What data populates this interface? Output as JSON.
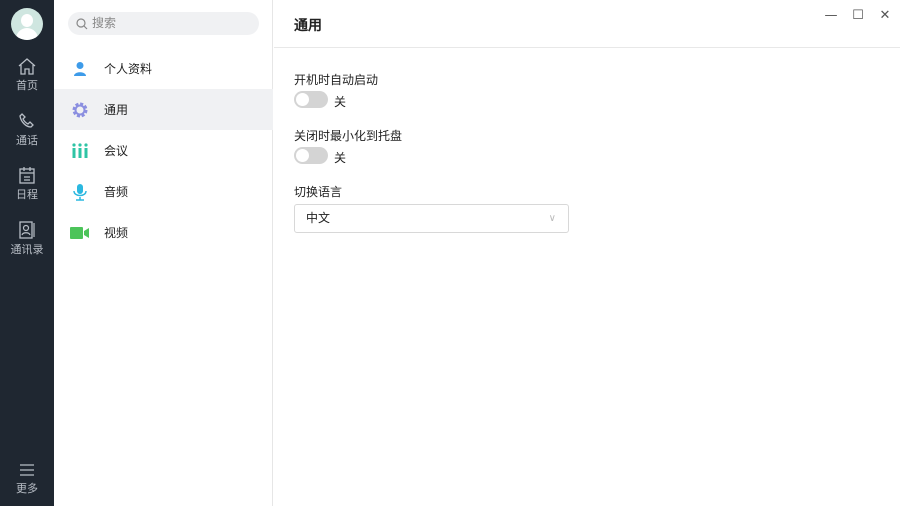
{
  "rail": {
    "items": [
      {
        "label": "首页",
        "icon": "home-icon"
      },
      {
        "label": "通话",
        "icon": "phone-icon"
      },
      {
        "label": "日程",
        "icon": "calendar-icon"
      },
      {
        "label": "通讯录",
        "icon": "contacts-icon"
      }
    ],
    "more": "更多"
  },
  "search": {
    "placeholder": "搜索"
  },
  "menu": [
    {
      "label": "个人资料",
      "icon": "user-icon",
      "color": "#3d9be9"
    },
    {
      "label": "通用",
      "icon": "gear-icon",
      "color": "#8b8fe0"
    },
    {
      "label": "会议",
      "icon": "meeting-icon",
      "color": "#2ec4a5"
    },
    {
      "label": "音频",
      "icon": "mic-icon",
      "color": "#2bb8e0"
    },
    {
      "label": "视频",
      "icon": "video-icon",
      "color": "#4cc45a"
    }
  ],
  "main": {
    "title": "通用",
    "settings": [
      {
        "label": "开机时自动启动",
        "state": "关"
      },
      {
        "label": "关闭时最小化到托盘",
        "state": "关"
      }
    ],
    "language": {
      "label": "切换语言",
      "value": "中文"
    }
  },
  "window": {
    "minimize": "—",
    "maximize": "☐",
    "close": "✕"
  }
}
